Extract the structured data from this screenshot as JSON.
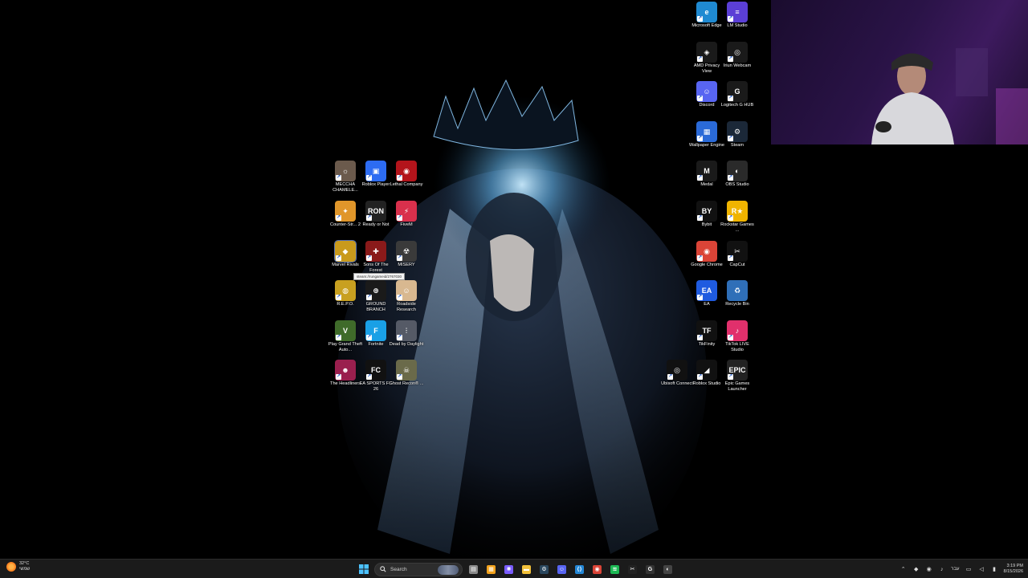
{
  "desktop": {
    "tooltip": "steam://rungameid/2767030",
    "icons": [
      {
        "label": "MECCHA CHAMELE...",
        "icon": "chameleon-icon",
        "color": "#6b5a4c"
      },
      {
        "label": "Roblox Player",
        "icon": "roblox-icon",
        "color": "#2d6cf2"
      },
      {
        "label": "Lethal Company",
        "icon": "lethal-company-icon",
        "color": "#b3141b"
      },
      {
        "label": "Counter-Str... 2",
        "icon": "cs2-icon",
        "color": "#e0962a"
      },
      {
        "label": "Ready or Not",
        "icon": "ready-or-not-icon",
        "color": "#222222"
      },
      {
        "label": "FiveM",
        "icon": "fivem-icon",
        "color": "#d9304c"
      },
      {
        "label": "Marvel Rivals",
        "icon": "marvel-rivals-icon",
        "color": "#c99a1c"
      },
      {
        "label": "Sons Of The Forest",
        "icon": "sons-of-the-forest-icon",
        "color": "#8a1a1a"
      },
      {
        "label": "MISERY",
        "icon": "misery-icon",
        "color": "#3a3a3a"
      },
      {
        "label": "R.E.P.O.",
        "icon": "repo-icon",
        "color": "#c8a020"
      },
      {
        "label": "GROUND BRANCH",
        "icon": "ground-branch-icon",
        "color": "#1a1a1a"
      },
      {
        "label": "Roadside Research",
        "icon": "roadside-research-icon",
        "color": "#d8b890"
      },
      {
        "label": "Play Grand Theft Auto...",
        "icon": "gta-icon",
        "color": "#3f6b2a"
      },
      {
        "label": "Fortnite",
        "icon": "fortnite-icon",
        "color": "#1aa0e6"
      },
      {
        "label": "Dead by Daylight",
        "icon": "dead-by-daylight-icon",
        "color": "#555a66"
      },
      {
        "label": "The Headliners",
        "icon": "headliners-icon",
        "color": "#9a1f4e"
      },
      {
        "label": "EA SPORTS FC 26",
        "icon": "ea-fc-icon",
        "color": "#111111"
      },
      {
        "label": "Ghost Recon® ...",
        "icon": "ghost-recon-icon",
        "color": "#6a6a4a"
      },
      {
        "label": "Microsoft Edge",
        "icon": "edge-icon",
        "color": "#1f8ad2"
      },
      {
        "label": "LM Studio",
        "icon": "lm-studio-icon",
        "color": "#5b3fd6"
      },
      {
        "label": "AMD Privacy View",
        "icon": "amd-privacy-icon",
        "color": "#1a1a1a"
      },
      {
        "label": "Iriun Webcam",
        "icon": "iriun-webcam-icon",
        "color": "#1a1a1a"
      },
      {
        "label": "Discord",
        "icon": "discord-icon",
        "color": "#5865f2"
      },
      {
        "label": "Logitech G HUB",
        "icon": "logitech-ghub-icon",
        "color": "#1a1a1a"
      },
      {
        "label": "Wallpaper Engine",
        "icon": "wallpaper-engine-icon",
        "color": "#2a6ad8"
      },
      {
        "label": "Steam",
        "icon": "steam-icon",
        "color": "#1b2838"
      },
      {
        "label": "Medal",
        "icon": "medal-icon",
        "color": "#1a1a1a"
      },
      {
        "label": "OBS Studio",
        "icon": "obs-icon",
        "color": "#2a2a2a"
      },
      {
        "label": "Bybit",
        "icon": "bybit-icon",
        "color": "#111111"
      },
      {
        "label": "Rockstar Games ...",
        "icon": "rockstar-icon",
        "color": "#f0b400"
      },
      {
        "label": "Google Chrome",
        "icon": "chrome-icon",
        "color": "#db4437"
      },
      {
        "label": "CapCut",
        "icon": "capcut-icon",
        "color": "#111111"
      },
      {
        "label": "EA",
        "icon": "ea-icon",
        "color": "#1f5be0"
      },
      {
        "label": "Recycle Bin",
        "icon": "recycle-bin-icon",
        "color": "#2f6fb8"
      },
      {
        "label": "TikFinity",
        "icon": "tikfinity-icon",
        "color": "#111111"
      },
      {
        "label": "TikTok LIVE Studio",
        "icon": "tiktok-live-icon",
        "color": "#e1306c"
      },
      {
        "label": "Ubisoft Connect",
        "icon": "ubisoft-icon",
        "color": "#111111"
      },
      {
        "label": "Roblox Studio",
        "icon": "roblox-studio-icon",
        "color": "#111111"
      },
      {
        "label": "Epic Games Launcher",
        "icon": "epic-games-icon",
        "color": "#222222"
      }
    ]
  },
  "taskbar": {
    "weather": {
      "temp": "32°C",
      "condition": "שמשי"
    },
    "search_label": "Search",
    "pinned": [
      {
        "icon": "windows-start-icon",
        "color": "#2f9bff"
      },
      {
        "icon": "task-view-icon",
        "color": "#8a8a8a"
      },
      {
        "icon": "widgets-icon",
        "color": "#f3a21c"
      },
      {
        "icon": "copilot-icon",
        "color": "#7a5cff"
      },
      {
        "icon": "file-explorer-icon",
        "color": "#f3c13a"
      },
      {
        "icon": "steam-taskbar-icon",
        "color": "#2a475e"
      },
      {
        "icon": "discord-taskbar-icon",
        "color": "#5865f2"
      },
      {
        "icon": "vscode-icon",
        "color": "#2387d6"
      },
      {
        "icon": "chrome-taskbar-icon",
        "color": "#db4437"
      },
      {
        "icon": "spotify-icon",
        "color": "#1db954"
      },
      {
        "icon": "capcut-taskbar-icon",
        "color": "#222222"
      },
      {
        "icon": "logitech-taskbar-icon",
        "color": "#333333"
      },
      {
        "icon": "obs-taskbar-icon",
        "color": "#444444"
      }
    ],
    "tray": {
      "lang": "עבר",
      "time": "3:19 PM",
      "date": "8/15/2026"
    }
  },
  "colors": {
    "taskbar_bg": "#1b1b1b",
    "accent": "#2f9bff"
  }
}
